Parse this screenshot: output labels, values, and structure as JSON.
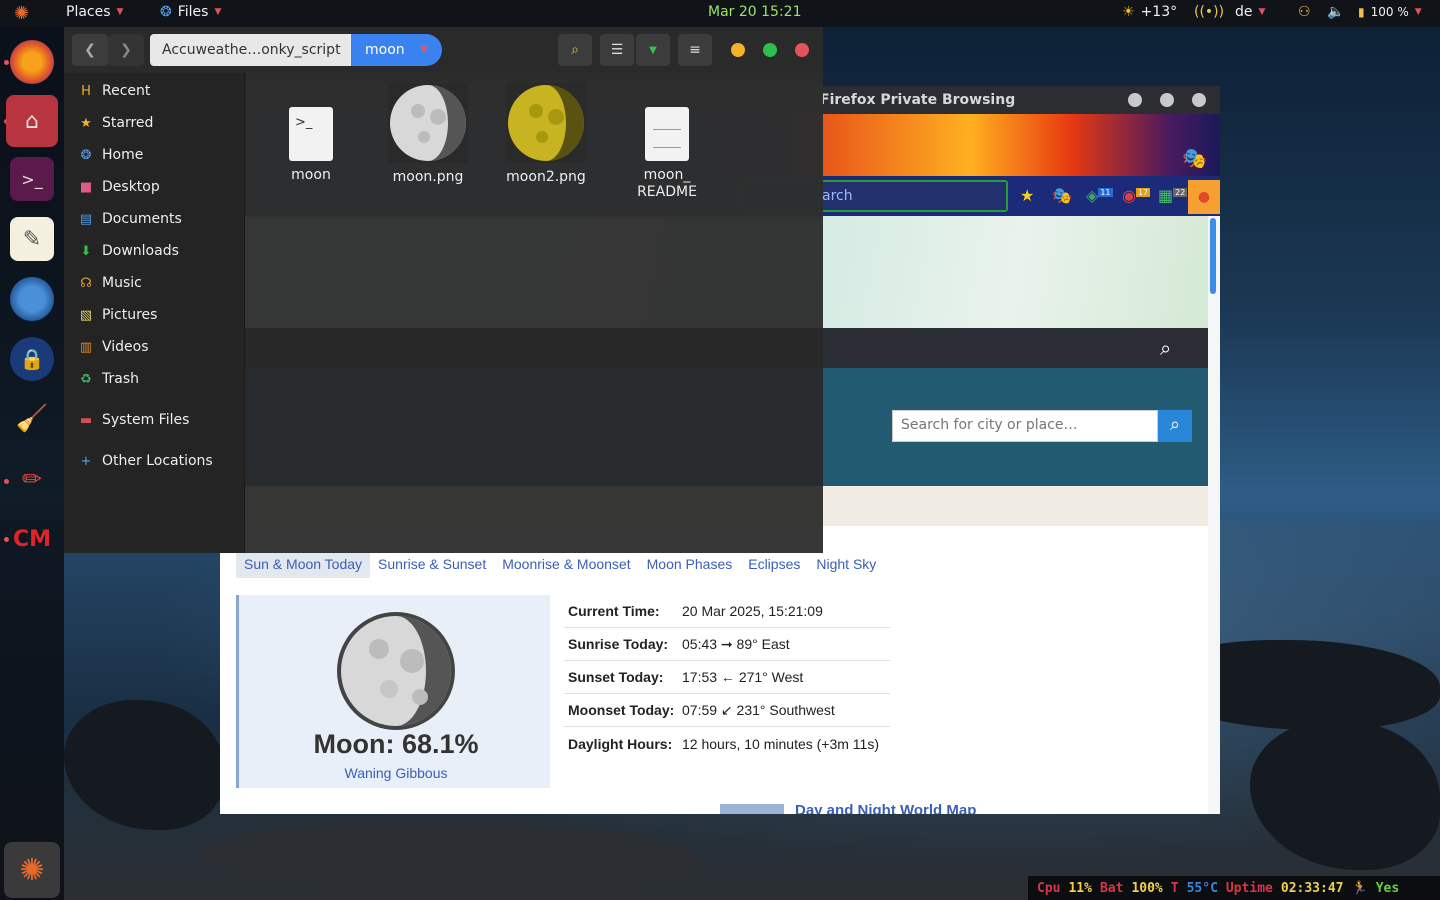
{
  "topbar": {
    "places": "Places",
    "files": "Files",
    "clock": "Mar 20  15:21",
    "weather": "+13°",
    "keyboard": "de",
    "battery": "100 %"
  },
  "files_window": {
    "breadcrumb_parent": "Accuweathe…onky_script",
    "breadcrumb_current": "moon",
    "sidebar": [
      {
        "label": "Recent"
      },
      {
        "label": "Starred"
      },
      {
        "label": "Home"
      },
      {
        "label": "Desktop"
      },
      {
        "label": "Documents"
      },
      {
        "label": "Downloads"
      },
      {
        "label": "Music"
      },
      {
        "label": "Pictures"
      },
      {
        "label": "Videos"
      },
      {
        "label": "Trash"
      },
      {
        "label": "System Files"
      },
      {
        "label": "Other Locations"
      }
    ],
    "files": [
      {
        "name": "moon"
      },
      {
        "name": "moon.png"
      },
      {
        "name": "moon2.png"
      },
      {
        "name": "moon_\nREADME"
      }
    ]
  },
  "firefox": {
    "title": "Firefox Private Browsing",
    "url_fragment": "arch",
    "badges": [
      "11",
      "17",
      "22"
    ],
    "city_search_placeholder": "Search for city or place…",
    "tabs": [
      "Sun & Moon Today",
      "Sunrise & Sunset",
      "Moonrise & Moonset",
      "Moon Phases",
      "Eclipses",
      "Night Sky"
    ],
    "moon_percent": "Moon: 68.1%",
    "moon_phase": "Waning Gibbous",
    "rows": [
      {
        "k": "Current Time:",
        "v": "20 Mar 2025, 15:21:09"
      },
      {
        "k": "Sunrise Today:",
        "v": "05:43 ➞  89° East"
      },
      {
        "k": "Sunset Today:",
        "v": "17:53 ←  271° West"
      },
      {
        "k": "Moonset Today:",
        "v": "07:59 ↙  231° Southwest"
      },
      {
        "k": "Daylight Hours:",
        "v": "12 hours, 10 minutes (+3m 11s)"
      }
    ],
    "world_map_link": "Day and Night World Map"
  },
  "conky": {
    "cpu_label": "Cpu",
    "cpu": "11%",
    "bat_label": "Bat",
    "bat": "100%",
    "temp_label": "T",
    "temp": "55°C",
    "uptime_label": "Uptime",
    "uptime": "02:33:47",
    "yes": "Yes"
  },
  "colors": {
    "accent": "#3a82f0",
    "close": "#e0545a",
    "minimize": "#f0b429",
    "maximize": "#2ac04a"
  }
}
